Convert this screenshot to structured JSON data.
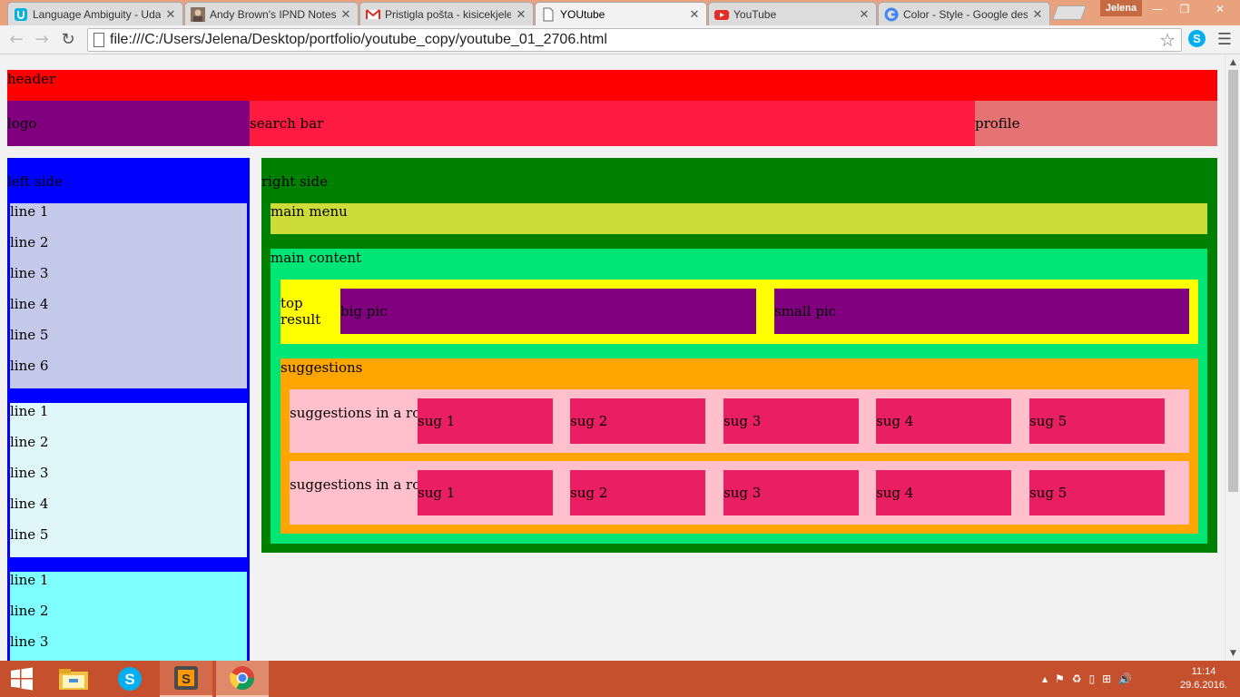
{
  "browser": {
    "tabs": [
      {
        "title": "Language Ambiguity - Udacity",
        "icon": "udacity-icon"
      },
      {
        "title": "Andy Brown's IPND Notes",
        "icon": "avatar-icon"
      },
      {
        "title": "Pristigla pošta - kisicekjelena",
        "icon": "gmail-icon"
      },
      {
        "title": "YOUtube",
        "icon": "file-icon"
      },
      {
        "title": "YouTube",
        "icon": "youtube-icon"
      },
      {
        "title": "Color - Style - Google design",
        "icon": "google-icon"
      }
    ],
    "active_tab_index": 3,
    "user_name": "Jelena",
    "url": "file:///C:/Users/Jelena/Desktop/portfolio/youtube_copy/youtube_01_2706.html"
  },
  "page": {
    "header": {
      "label": "header",
      "logo": "logo",
      "search_bar": "search bar",
      "profile": "profile"
    },
    "left_side": {
      "label": "left side",
      "group1": [
        "line 1",
        "line 2",
        "line 3",
        "line 4",
        "line 5",
        "line 6"
      ],
      "group2": [
        "line 1",
        "line 2",
        "line 3",
        "line 4",
        "line 5"
      ],
      "group3": [
        "line 1",
        "line 2",
        "line 3"
      ]
    },
    "right_side": {
      "label": "right side",
      "main_menu": "main menu",
      "main_content": {
        "label": "main content",
        "top_result": {
          "label": "top result",
          "big_pic": "big pic",
          "small_pic": "small pic"
        },
        "suggestions": {
          "label": "suggestions",
          "rows": [
            {
              "label": "suggestions in a row",
              "items": [
                "sug 1",
                "sug 2",
                "sug 3",
                "sug 4",
                "sug 5"
              ]
            },
            {
              "label": "suggestions in a row",
              "items": [
                "sug 1",
                "sug 2",
                "sug 3",
                "sug 4",
                "sug 5"
              ]
            }
          ]
        }
      }
    }
  },
  "taskbar": {
    "apps": [
      "file-explorer-icon",
      "skype-icon",
      "sublime-text-icon",
      "chrome-icon"
    ],
    "time": "11:14",
    "date": "29.6.2016."
  },
  "colors": {
    "header": "#ff0000",
    "logo": "#800080",
    "search_bar": "#ff1a42",
    "profile": "#e57373",
    "left_side": "#0000ff",
    "right_side": "#008000",
    "main_menu": "#cddc39",
    "main_content": "#00e676",
    "top_result": "#ffff00",
    "suggestions": "#ffa500",
    "sug_row": "#ffc0cb",
    "sug_item": "#e91e63"
  }
}
